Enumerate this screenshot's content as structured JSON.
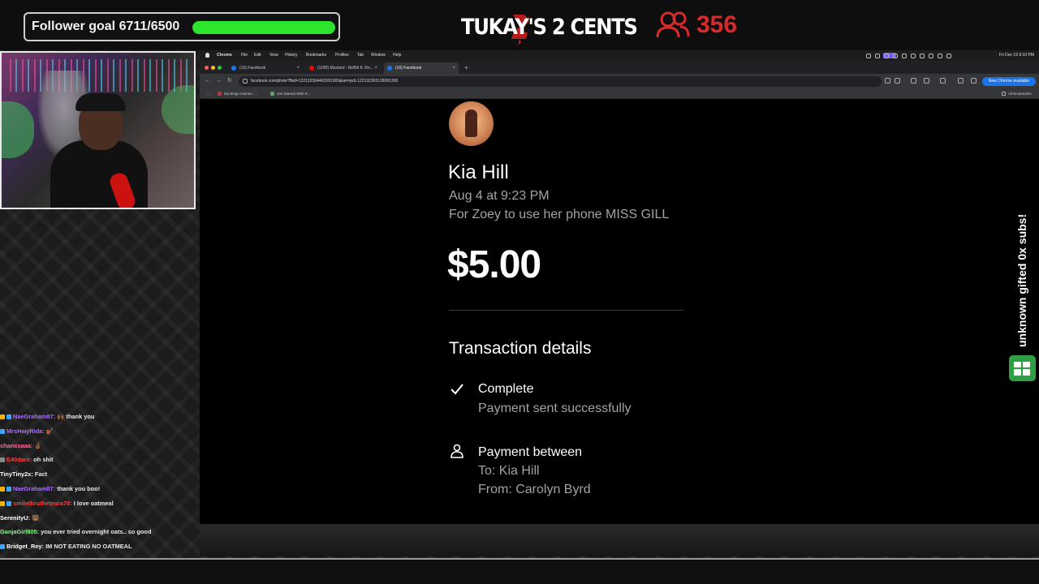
{
  "overlay": {
    "follower_goal_text": "Follower goal 6711/6500",
    "follower_goal_progress": 1.0,
    "brand_logo_text": "TUKAY'S 2 CENTS",
    "viewer_count": "356",
    "sub_alert_text": "unknown gifted 0x subs!",
    "colors": {
      "goal_bar": "#2ee52e",
      "viewer": "#d82a2a",
      "sub_badge": "#2ea043"
    }
  },
  "chat": [
    {
      "user": "NaeGraham87:",
      "message": "🙌🏾 thank you",
      "user_color": "#a970ff",
      "badges": [
        "#f4b400",
        "#3ea6ff"
      ]
    },
    {
      "user": "MrsHwyRida:",
      "message": "💅🏾",
      "user_color": "#a970ff",
      "badges": [
        "#3ea6ff"
      ]
    },
    {
      "user": "shanxxaaa:",
      "message": "🤞🏾",
      "user_color": "#ff6b9a",
      "badges": []
    },
    {
      "user": "E40dare:",
      "message": "oh shit",
      "user_color": "#ff4040",
      "badges": [
        "#888888"
      ]
    },
    {
      "user": "TinyTiny2x:",
      "message": "Fact",
      "user_color": "#ffffff",
      "badges": []
    },
    {
      "user": "NaeGraham87:",
      "message": "thank you boo!",
      "user_color": "#a970ff",
      "badges": [
        "#f4b400",
        "#3ea6ff"
      ]
    },
    {
      "user": "smilethrutheteara78:",
      "message": "I love oatmeal",
      "user_color": "#ff4040",
      "badges": [
        "#f4b400",
        "#3ea6ff"
      ]
    },
    {
      "user": "SerenityU:",
      "message": "🐻",
      "user_color": "#ffffff",
      "badges": []
    },
    {
      "user": "GanjaGirl805:",
      "message": "you ever tried overnight oats.. so good",
      "user_color": "#7fff7f",
      "badges": []
    },
    {
      "user": "Bridget_Rey:",
      "message": "IM NOT EATING NO OATMEAL",
      "user_color": "#ffffff",
      "badges": [
        "#3ea6ff"
      ]
    }
  ],
  "browser": {
    "menubar": {
      "app": "Chrome",
      "items": [
        "File",
        "Edit",
        "View",
        "History",
        "Bookmarks",
        "Profiles",
        "Tab",
        "Window",
        "Help"
      ],
      "clock": "Fri Dec 19 9:10 PM"
    },
    "tabs": [
      {
        "title": "(16) Facebook",
        "active": false,
        "favicon_color": "#1877f2"
      },
      {
        "title": "(1189) Mustard - BeBitt ft. Ro...",
        "active": false,
        "favicon_color": "#ff0000"
      },
      {
        "title": "(16) Facebook",
        "active": true,
        "favicon_color": "#1877f2"
      }
    ],
    "url": "facebook.com/photo?fbid=122132364462991365&set=pcb.122132365136991365",
    "update_button": "New Chrome available",
    "bookmarks": [
      {
        "label": "My Bingo Games -...",
        "color": "#b03a3a"
      },
      {
        "label": "Get Started With R...",
        "color": "#4caf50"
      }
    ],
    "all_bookmarks": "All Bookmarks"
  },
  "transaction": {
    "payee": "Kia Hill",
    "date": "Aug 4 at 9:23 PM",
    "note": "For Zoey to use her phone MISS GILL",
    "amount": "$5.00",
    "details_title": "Transaction details",
    "status_label": "Complete",
    "status_sub": "Payment sent successfully",
    "parties_label": "Payment between",
    "to_line": "To: Kia Hill",
    "from_line": "From: Carolyn Byrd"
  }
}
